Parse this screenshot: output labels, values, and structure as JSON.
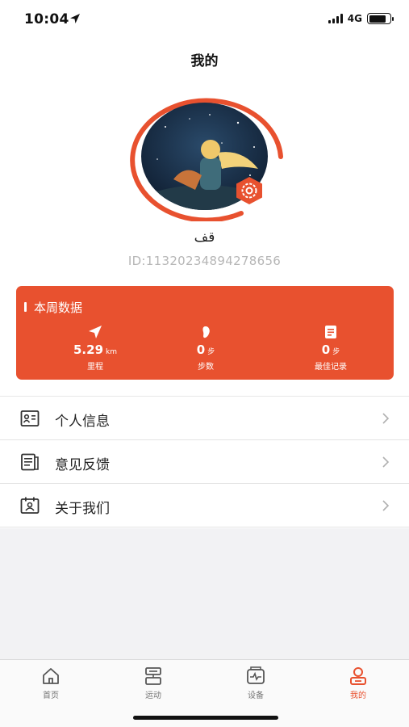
{
  "status_bar": {
    "time": "10:04",
    "network": "4G"
  },
  "header": {
    "title": "我的"
  },
  "profile": {
    "username": "قف",
    "user_id": "ID:11320234894278656"
  },
  "weekly_card": {
    "title": "本周数据",
    "stats": [
      {
        "icon": "paper-plane-icon",
        "value": "5.29",
        "unit": "km",
        "label": "里程"
      },
      {
        "icon": "footprint-icon",
        "value": "0",
        "unit": "步",
        "label": "步数"
      },
      {
        "icon": "record-icon",
        "value": "0",
        "unit": "步",
        "label": "最佳记录"
      }
    ]
  },
  "menu": [
    {
      "icon": "id-card-icon",
      "label": "个人信息"
    },
    {
      "icon": "feedback-icon",
      "label": "意见反馈"
    },
    {
      "icon": "about-icon",
      "label": "关于我们"
    }
  ],
  "tab_bar": [
    {
      "icon": "home-icon",
      "label": "首页",
      "active": false
    },
    {
      "icon": "sport-icon",
      "label": "运动",
      "active": false
    },
    {
      "icon": "device-icon",
      "label": "设备",
      "active": false
    },
    {
      "icon": "profile-icon",
      "label": "我的",
      "active": true
    }
  ],
  "colors": {
    "accent": "#e8512f",
    "text": "#222222",
    "muted": "#b6b6b6",
    "background_gray": "#f2f2f4"
  }
}
